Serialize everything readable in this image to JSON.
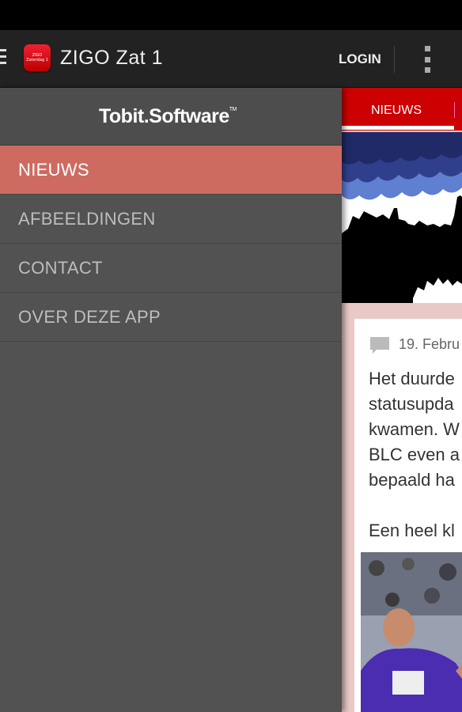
{
  "app": {
    "title": "ZIGO Zat 1",
    "icon_text": "ZIGO Zaterdag 1"
  },
  "actionbar": {
    "login_label": "LOGIN"
  },
  "drawer": {
    "logo": "Tobit.Software",
    "logo_tm": "TM",
    "items": [
      {
        "label": "NIEUWS",
        "active": true
      },
      {
        "label": "AFBEELDINGEN",
        "active": false
      },
      {
        "label": "CONTACT",
        "active": false
      },
      {
        "label": "OVER DEZE APP",
        "active": false
      }
    ]
  },
  "content": {
    "tab_label": "NIEUWS",
    "post": {
      "date": "19. Febru",
      "lines": [
        "Het duurde",
        "statusupda",
        "kwamen. W",
        "BLC even a",
        "bepaald ha"
      ],
      "line2": "Een heel kl"
    }
  },
  "colors": {
    "accent": "#cc0000",
    "drawer_active": "#cd6b61",
    "drawer_bg": "#525252"
  }
}
